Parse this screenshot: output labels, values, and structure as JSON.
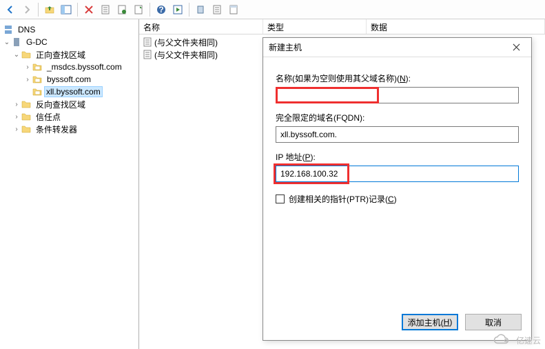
{
  "toolbar": {
    "back": "back",
    "forward": "forward",
    "up": "up",
    "show_hide": "show-hide",
    "delete": "delete",
    "refresh": "refresh",
    "export": "export",
    "new_query": "new-query",
    "help": "help",
    "run": "run",
    "new1": "new-window",
    "new2": "new-record",
    "props": "properties"
  },
  "tree": {
    "root": "DNS",
    "server": "G-DC",
    "forward": "正向查找区域",
    "zone_msdcs": "_msdcs.byssoft.com",
    "zone_byssoft": "byssoft.com",
    "zone_xll": "xll.byssoft.com",
    "reverse": "反向查找区域",
    "trust": "信任点",
    "conditional": "条件转发器"
  },
  "list": {
    "headers": {
      "name": "名称",
      "type": "类型",
      "data": "数据"
    },
    "same_as_parent": "(与父文件夹相同)"
  },
  "dialog": {
    "title": "新建主机",
    "name_label_pre": "名称(如果为空则使用其父域名称)(",
    "name_label_key": "N",
    "name_label_post": "):",
    "name_value": "",
    "fqdn_label": "完全限定的域名(FQDN):",
    "fqdn_value": "xll.byssoft.com.",
    "ip_label_pre": "IP 地址(",
    "ip_label_key": "P",
    "ip_label_post": "):",
    "ip_value": "192.168.100.32",
    "ptr_label_pre": "创建相关的指针(PTR)记录(",
    "ptr_label_key": "C",
    "ptr_label_post": ")",
    "add_host_pre": "添加主机(",
    "add_host_key": "H",
    "add_host_post": ")",
    "cancel": "取消"
  },
  "watermark": "亿速云"
}
